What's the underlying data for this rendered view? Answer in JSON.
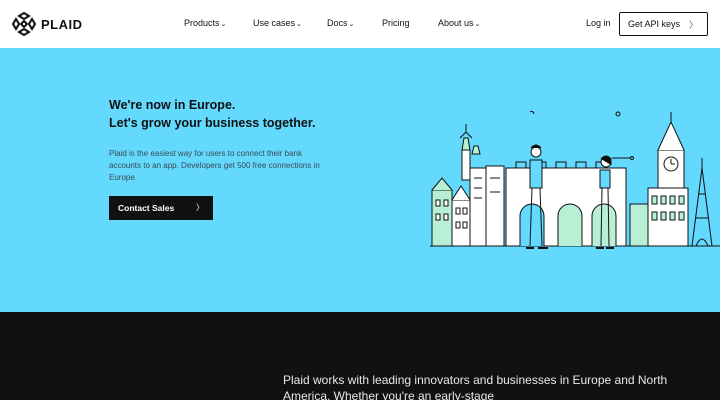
{
  "brand": {
    "name": "PLAID",
    "logo_icon": "plaid-logo-icon"
  },
  "nav": {
    "items": [
      {
        "label": "Products",
        "dropdown": true
      },
      {
        "label": "Use cases",
        "dropdown": true
      },
      {
        "label": "Docs",
        "dropdown": true
      },
      {
        "label": "Pricing",
        "dropdown": false
      },
      {
        "label": "About us",
        "dropdown": true
      }
    ],
    "login": "Log in",
    "cta": "Get API keys"
  },
  "hero": {
    "title_line1": "We're now in Europe.",
    "title_line2": "Let's grow your business together.",
    "description": "Plaid is the easiest way for users to connect their bank accounts to an app. Developers get 500 free connections in Europe.",
    "button": "Contact Sales",
    "illustration": "europe-landmarks-illustration"
  },
  "section2": {
    "text": "Plaid works with leading innovators and businesses in Europe and North America. Whether you're an early-stage"
  },
  "colors": {
    "hero_bg": "#63d9fd",
    "dark_bg": "#111111",
    "accent_green": "#b8f0d6",
    "text_dark": "#111111"
  }
}
